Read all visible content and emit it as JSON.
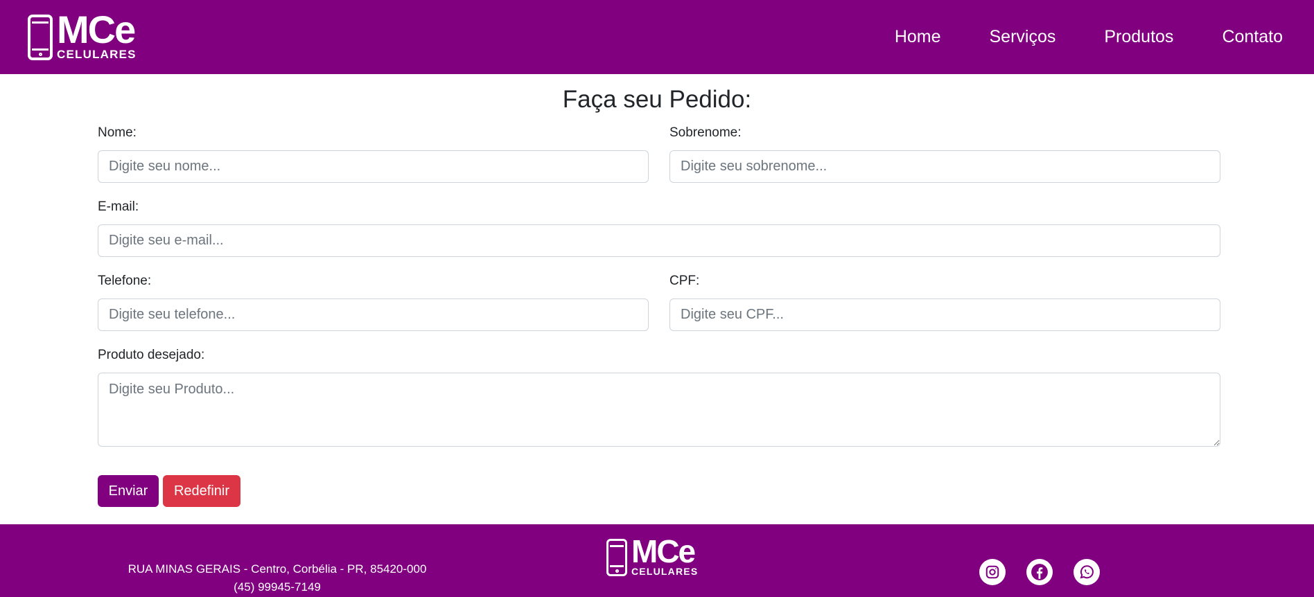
{
  "nav": {
    "logo_main": "MCe",
    "logo_sub": "CELULARES",
    "links": [
      "Home",
      "Serviços",
      "Produtos",
      "Contato"
    ]
  },
  "form": {
    "title": "Faça seu Pedido:",
    "nome_label": "Nome:",
    "nome_placeholder": "Digite seu nome...",
    "sobrenome_label": "Sobrenome:",
    "sobrenome_placeholder": "Digite seu sobrenome...",
    "email_label": "E-mail:",
    "email_placeholder": "Digite seu e-mail...",
    "telefone_label": "Telefone:",
    "telefone_placeholder": "Digite seu telefone...",
    "cpf_label": "CPF:",
    "cpf_placeholder": "Digite seu CPF...",
    "produto_label": "Produto desejado:",
    "produto_placeholder": "Digite seu Produto...",
    "submit_label": "Enviar",
    "reset_label": "Redefinir"
  },
  "footer": {
    "address": "RUA MINAS GERAIS - Centro, Corbélia - PR, 85420-000",
    "phone": "(45) 99945-7149",
    "logo_main": "MCe",
    "logo_sub": "CELULARES",
    "social_icons": [
      "instagram-icon",
      "facebook-icon",
      "whatsapp-icon"
    ]
  },
  "colors": {
    "brand": "#800080",
    "danger": "#dc3545"
  }
}
